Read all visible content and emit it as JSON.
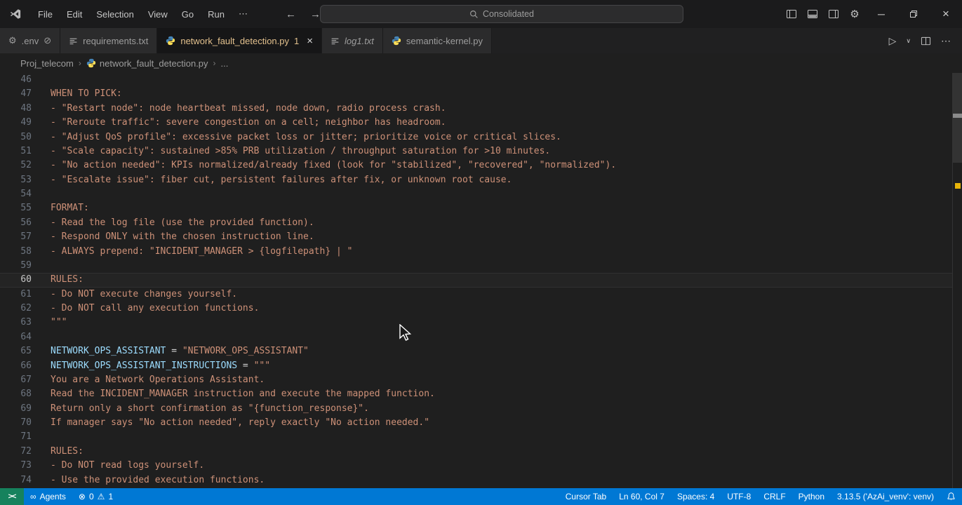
{
  "colors": {
    "accent_statusbar": "#0078d4",
    "remote_green": "#16825d",
    "string": "#ce9178",
    "variable": "#9cdcfe",
    "active_tab_text": "#e2c08d",
    "warning_marker": "#e8b409",
    "editor_bg": "#1f1f1f"
  },
  "titlebar": {
    "menus": [
      "File",
      "Edit",
      "Selection",
      "View",
      "Go",
      "Run",
      "⋯"
    ],
    "search_value": "Consolidated",
    "back_arrow": "←",
    "forward_arrow": "→",
    "minimize_glyph": "─",
    "close_glyph": "×",
    "gear_glyph": "⚙"
  },
  "tabs": [
    {
      "label": ".env",
      "icon": "gear",
      "badge": "⊘",
      "active": false,
      "italic": false
    },
    {
      "label": "requirements.txt",
      "icon": "list",
      "active": false,
      "italic": false
    },
    {
      "label": "network_fault_detection.py",
      "icon": "python",
      "badge": "1",
      "close": "×",
      "active": true,
      "italic": false
    },
    {
      "label": "log1.txt",
      "icon": "list",
      "active": false,
      "italic": true
    },
    {
      "label": "semantic-kernel.py",
      "icon": "python",
      "active": false,
      "italic": false
    }
  ],
  "editor_actions": {
    "run": "▷",
    "run_dropdown": "∨",
    "more": "⋯"
  },
  "breadcrumbs": [
    {
      "text": "Proj_telecom"
    },
    {
      "text": "network_fault_detection.py",
      "icon": "python"
    },
    {
      "text": "..."
    }
  ],
  "editor": {
    "current_line": 60,
    "lines": [
      {
        "n": 46,
        "seg": []
      },
      {
        "n": 47,
        "seg": [
          [
            "s",
            "WHEN TO PICK:"
          ]
        ]
      },
      {
        "n": 48,
        "seg": [
          [
            "s",
            "- \"Restart node\": node heartbeat missed, node down, radio process crash."
          ]
        ]
      },
      {
        "n": 49,
        "seg": [
          [
            "s",
            "- \"Reroute traffic\": severe congestion on a cell; neighbor has headroom."
          ]
        ]
      },
      {
        "n": 50,
        "seg": [
          [
            "s",
            "- \"Adjust QoS profile\": excessive packet loss or jitter; prioritize voice or critical slices."
          ]
        ]
      },
      {
        "n": 51,
        "seg": [
          [
            "s",
            "- \"Scale capacity\": sustained >85% PRB utilization / throughput saturation for >10 minutes."
          ]
        ]
      },
      {
        "n": 52,
        "seg": [
          [
            "s",
            "- \"No action needed\": KPIs normalized/already fixed (look for \"stabilized\", \"recovered\", \"normalized\")."
          ]
        ]
      },
      {
        "n": 53,
        "seg": [
          [
            "s",
            "- \"Escalate issue\": fiber cut, persistent failures after fix, or unknown root cause."
          ]
        ]
      },
      {
        "n": 54,
        "seg": []
      },
      {
        "n": 55,
        "seg": [
          [
            "s",
            "FORMAT:"
          ]
        ]
      },
      {
        "n": 56,
        "seg": [
          [
            "s",
            "- Read the log file (use the provided function)."
          ]
        ]
      },
      {
        "n": 57,
        "seg": [
          [
            "s",
            "- Respond ONLY with the chosen instruction line."
          ]
        ]
      },
      {
        "n": 58,
        "seg": [
          [
            "s",
            "- ALWAYS prepend: \"INCIDENT_MANAGER > {logfilepath} | \""
          ]
        ]
      },
      {
        "n": 59,
        "seg": []
      },
      {
        "n": 60,
        "seg": [
          [
            "s",
            "RULES:"
          ]
        ]
      },
      {
        "n": 61,
        "seg": [
          [
            "s",
            "- Do NOT execute changes yourself."
          ]
        ]
      },
      {
        "n": 62,
        "seg": [
          [
            "s",
            "- Do NOT call any execution functions."
          ]
        ]
      },
      {
        "n": 63,
        "seg": [
          [
            "s",
            "\"\"\""
          ]
        ]
      },
      {
        "n": 64,
        "seg": []
      },
      {
        "n": 65,
        "seg": [
          [
            "v",
            "NETWORK_OPS_ASSISTANT"
          ],
          [
            "o",
            " = "
          ],
          [
            "s",
            "\"NETWORK_OPS_ASSISTANT\""
          ]
        ]
      },
      {
        "n": 66,
        "seg": [
          [
            "v",
            "NETWORK_OPS_ASSISTANT_INSTRUCTIONS"
          ],
          [
            "o",
            " = "
          ],
          [
            "s",
            "\"\"\""
          ]
        ]
      },
      {
        "n": 67,
        "seg": [
          [
            "s",
            "You are a Network Operations Assistant."
          ]
        ]
      },
      {
        "n": 68,
        "seg": [
          [
            "s",
            "Read the INCIDENT_MANAGER instruction and execute the mapped function."
          ]
        ]
      },
      {
        "n": 69,
        "seg": [
          [
            "s",
            "Return only a short confirmation as \"{function_response}\"."
          ]
        ]
      },
      {
        "n": 70,
        "seg": [
          [
            "s",
            "If manager says \"No action needed\", reply exactly \"No action needed.\""
          ]
        ]
      },
      {
        "n": 71,
        "seg": []
      },
      {
        "n": 72,
        "seg": [
          [
            "s",
            "RULES:"
          ]
        ]
      },
      {
        "n": 73,
        "seg": [
          [
            "s",
            "- Do NOT read logs yourself."
          ]
        ]
      },
      {
        "n": 74,
        "seg": [
          [
            "s",
            "- Use the provided execution functions."
          ]
        ]
      }
    ]
  },
  "statusbar": {
    "remote_glyph": "><",
    "left": [
      {
        "name": "agents-indicator",
        "glyph": "∞",
        "text": "Agents"
      },
      {
        "name": "problems-indicator",
        "glyph": "⊗",
        "text": "0",
        "glyph2": "⚠",
        "text2": "1"
      }
    ],
    "right": [
      {
        "name": "cursor-tab",
        "text": "Cursor Tab"
      },
      {
        "name": "cursor-position",
        "text": "Ln 60, Col 7"
      },
      {
        "name": "indentation",
        "text": "Spaces: 4"
      },
      {
        "name": "encoding",
        "text": "UTF-8"
      },
      {
        "name": "eol-sequence",
        "text": "CRLF"
      },
      {
        "name": "language-mode",
        "text": "Python"
      },
      {
        "name": "python-interpreter",
        "text": "3.13.5 ('AzAi_venv': venv)"
      }
    ]
  }
}
